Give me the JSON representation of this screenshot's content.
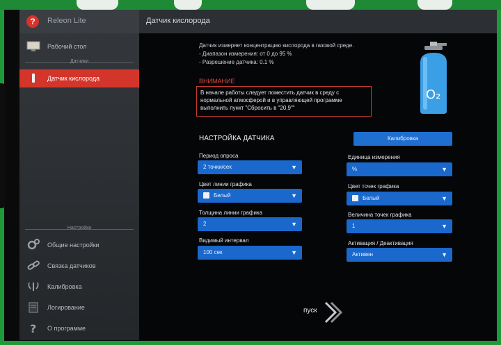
{
  "app": {
    "title": "Releon Lite"
  },
  "sidebar": {
    "items": [
      {
        "label": "Рабочий стол",
        "icon": "desktop-icon"
      },
      {
        "label": "Датчик кислорода",
        "icon": "sensor-icon",
        "active": true
      }
    ],
    "section_sensors": "Датчики",
    "section_settings": "Настройки",
    "settings_items": [
      {
        "label": "Общие настройки",
        "icon": "gears-icon"
      },
      {
        "label": "Связка датчиков",
        "icon": "link-icon"
      },
      {
        "label": "Калибровка",
        "icon": "calibration-icon"
      },
      {
        "label": "Логирование",
        "icon": "log-icon"
      },
      {
        "label": "О программе",
        "icon": "question-icon"
      }
    ]
  },
  "content": {
    "title": "Датчик кислорода",
    "description": [
      "Датчик измеряет концентрацию кислорода в газовой среде.",
      "- Диапазон измерения: от 0 до 95 %",
      "- Разрешение датчика: 0.1 %"
    ],
    "warning_title": "ВНИМАНИЕ",
    "warning_text": "В начале работы следует поместить датчик в среду с нормальной атмосферой и в управляющей программе выполнить пункт \"Сбросить в \"20,9\"\"",
    "bottle_label": "O₂",
    "settings_title": "НАСТРОЙКА ДАТЧИКА",
    "calibration_button": "Калибровка",
    "fields": {
      "poll_period": {
        "label": "Период опроса",
        "value": "2 точки/сек"
      },
      "unit": {
        "label": "Единица измерения",
        "value": "%"
      },
      "line_color": {
        "label": "Цвет линии графика",
        "value": "Белый"
      },
      "point_color": {
        "label": "Цвет точек графика",
        "value": "Белый"
      },
      "line_width": {
        "label": "Толщина линии графика",
        "value": "2"
      },
      "point_size": {
        "label": "Величина точек графика",
        "value": "1"
      },
      "visible_interval": {
        "label": "Видимый интервал",
        "value": "100 сек"
      },
      "activation": {
        "label": "Активация / Деактивация",
        "value": "Активен"
      }
    },
    "start_label": "пуск"
  },
  "colors": {
    "accent_red": "#d4352b",
    "select_blue": "#1a68cc",
    "frame_green": "#1f9a3a"
  }
}
